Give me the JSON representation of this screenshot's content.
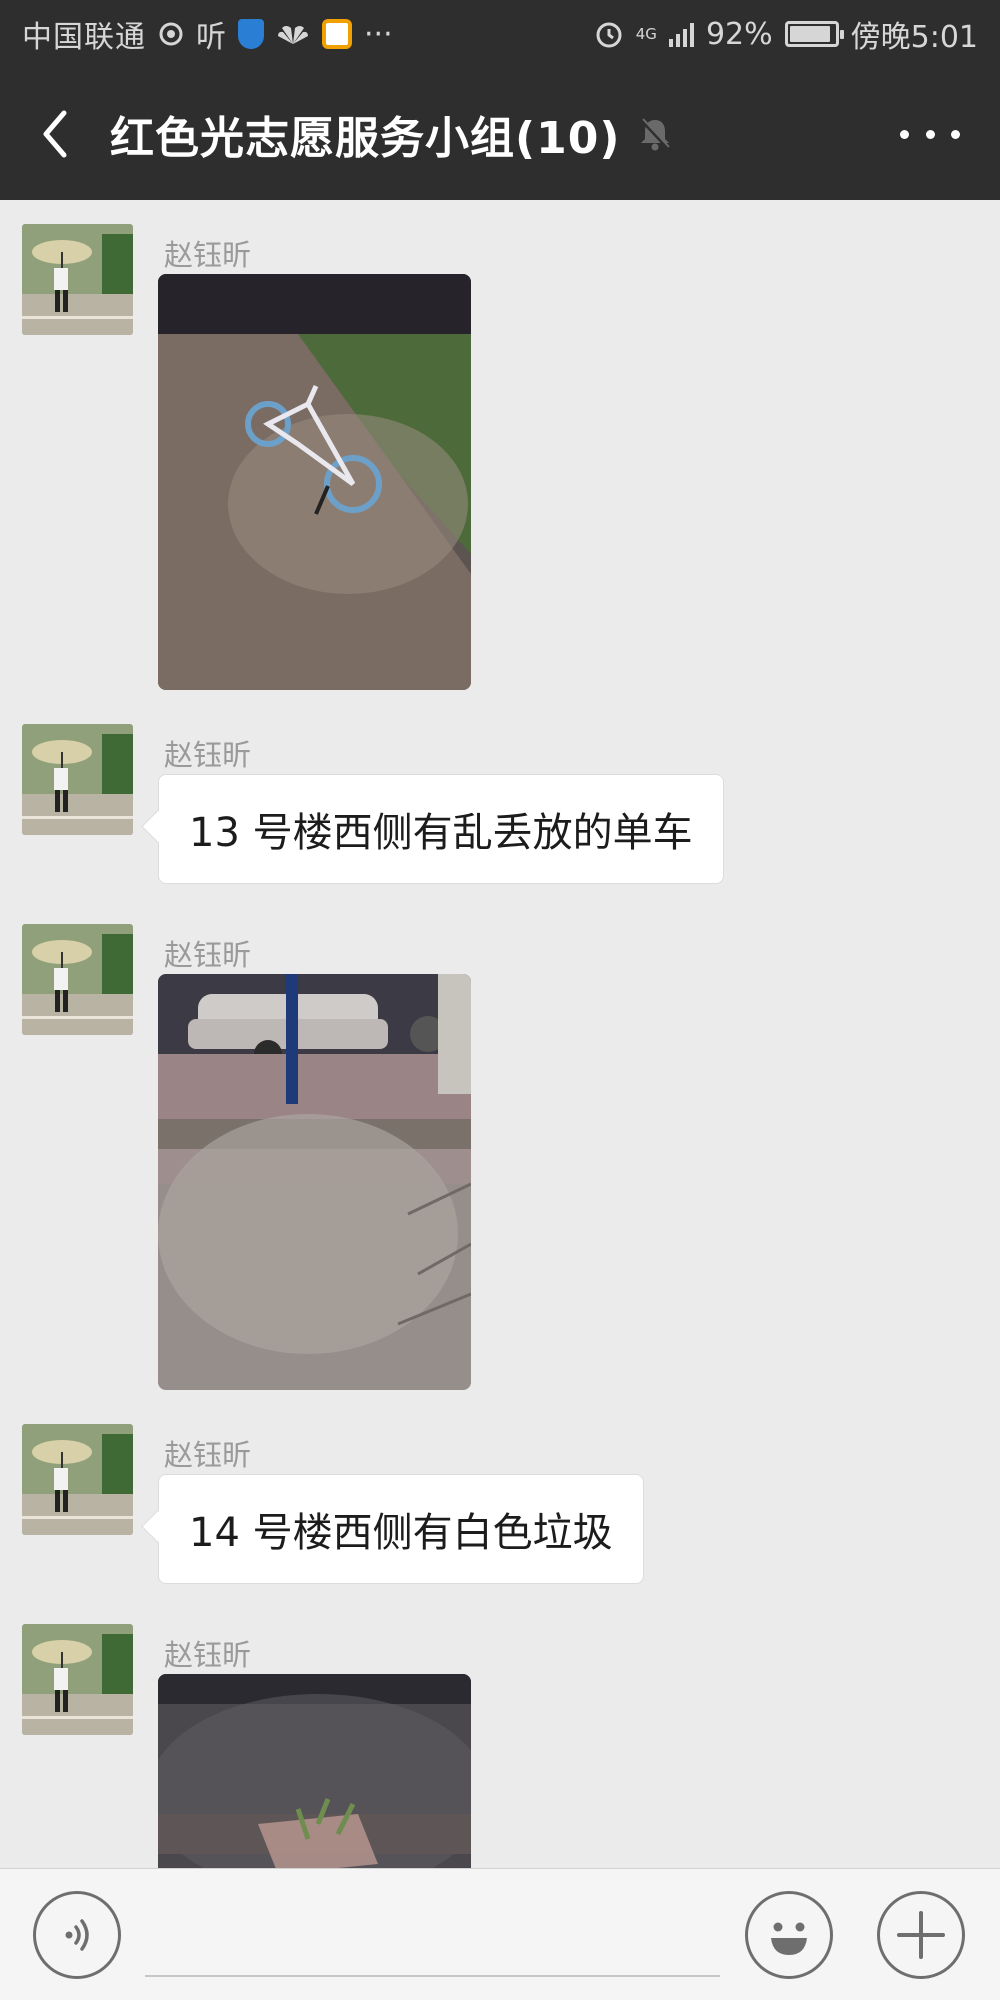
{
  "status_bar": {
    "carrier": "中国联通",
    "listen_text": "听",
    "more_dots": "···",
    "network": "4G",
    "battery": "92%",
    "battery_level": 0.92,
    "time": "傍晚5:01"
  },
  "header": {
    "title": "红色光志愿服务小组(10)",
    "back_icon": "chevron-left-icon",
    "mute_icon": "bell-muted-icon",
    "more_icon": "more-horizontal-icon"
  },
  "messages": [
    {
      "sender": "赵钰昕",
      "type": "image",
      "image": "bicycle-at-night"
    },
    {
      "sender": "赵钰昕",
      "type": "text",
      "text": "13 号楼西侧有乱丢放的单车"
    },
    {
      "sender": "赵钰昕",
      "type": "image",
      "image": "sidewalk-with-car"
    },
    {
      "sender": "赵钰昕",
      "type": "text",
      "text": "14 号楼西侧有白色垃圾"
    },
    {
      "sender": "赵钰昕",
      "type": "image",
      "image": "dark-street"
    }
  ],
  "input_bar": {
    "voice_icon": "voice-icon",
    "emoji_icon": "emoji-icon",
    "plus_icon": "plus-icon",
    "text_value": ""
  },
  "colors": {
    "header_bg": "#2e2e2e",
    "chat_bg": "#ebebeb",
    "bubble_bg": "#ffffff",
    "sender_text": "#9a9a9a"
  }
}
